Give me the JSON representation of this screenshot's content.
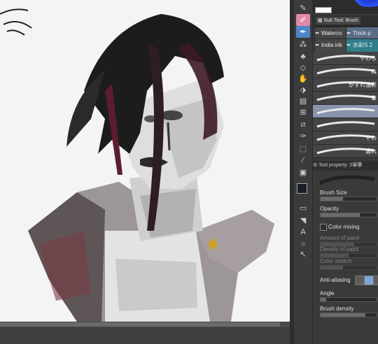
{
  "canvas": {
    "name": "illustration-canvas"
  },
  "toolbar": {
    "tools": [
      {
        "id": "pen",
        "icon": "✎"
      },
      {
        "id": "pencil",
        "icon": "✐"
      },
      {
        "id": "brush",
        "icon": "✒"
      },
      {
        "id": "airbrush",
        "icon": "⁂"
      },
      {
        "id": "decoration",
        "icon": "♣"
      },
      {
        "id": "eraser",
        "icon": "◇"
      },
      {
        "id": "blend",
        "icon": "✋"
      },
      {
        "id": "fill",
        "icon": "⬗"
      },
      {
        "id": "gradient",
        "icon": "▤"
      },
      {
        "id": "figure",
        "icon": "⊞"
      },
      {
        "id": "ruler",
        "icon": "⧄"
      },
      {
        "id": "eyedropper",
        "icon": "✑"
      },
      {
        "id": "select",
        "icon": "⬚"
      },
      {
        "id": "line",
        "icon": "⁄"
      },
      {
        "id": "frame",
        "icon": "▣"
      },
      {
        "id": "balloon",
        "icon": "▭"
      },
      {
        "id": "correct-line",
        "icon": "◥"
      },
      {
        "id": "text",
        "icon": "A"
      },
      {
        "id": "lasso",
        "icon": "○"
      },
      {
        "id": "move",
        "icon": "↖"
      }
    ]
  },
  "subtool": {
    "tab_label": "Sub Tool: Brush",
    "groups": [
      {
        "label": "Waterco"
      },
      {
        "label": "Thick p"
      },
      {
        "label": "India ink"
      },
      {
        "label": "水彩S 2"
      }
    ],
    "brushes": [
      {
        "name": "やわら"
      },
      {
        "name": "ぬ"
      },
      {
        "name": "かすれ油彩"
      },
      {
        "name": "筆"
      },
      {
        "name": ""
      },
      {
        "name": ""
      },
      {
        "name": "やわ"
      },
      {
        "name": "濃れ"
      }
    ]
  },
  "tool_property": {
    "header": "Tool property: 0筆蕈",
    "brush_size_label": "Brush Size",
    "opacity_label": "Opacity",
    "color_mixing_label": "Color mixing",
    "amount_of_paint_label": "Amount of paint",
    "density_of_paint_label": "Density of paint",
    "color_stretch_label": "Color stretch",
    "anti_aliasing_label": "Anti-aliasing",
    "angle_label": "Angle",
    "brush_density_label": "Brush density",
    "brush_size_value": 0.4,
    "opacity_value": 0.7
  },
  "colors": {
    "main_color": "#1a1d24",
    "sub_color": "#ffffff",
    "accent": "#4f86c6"
  }
}
